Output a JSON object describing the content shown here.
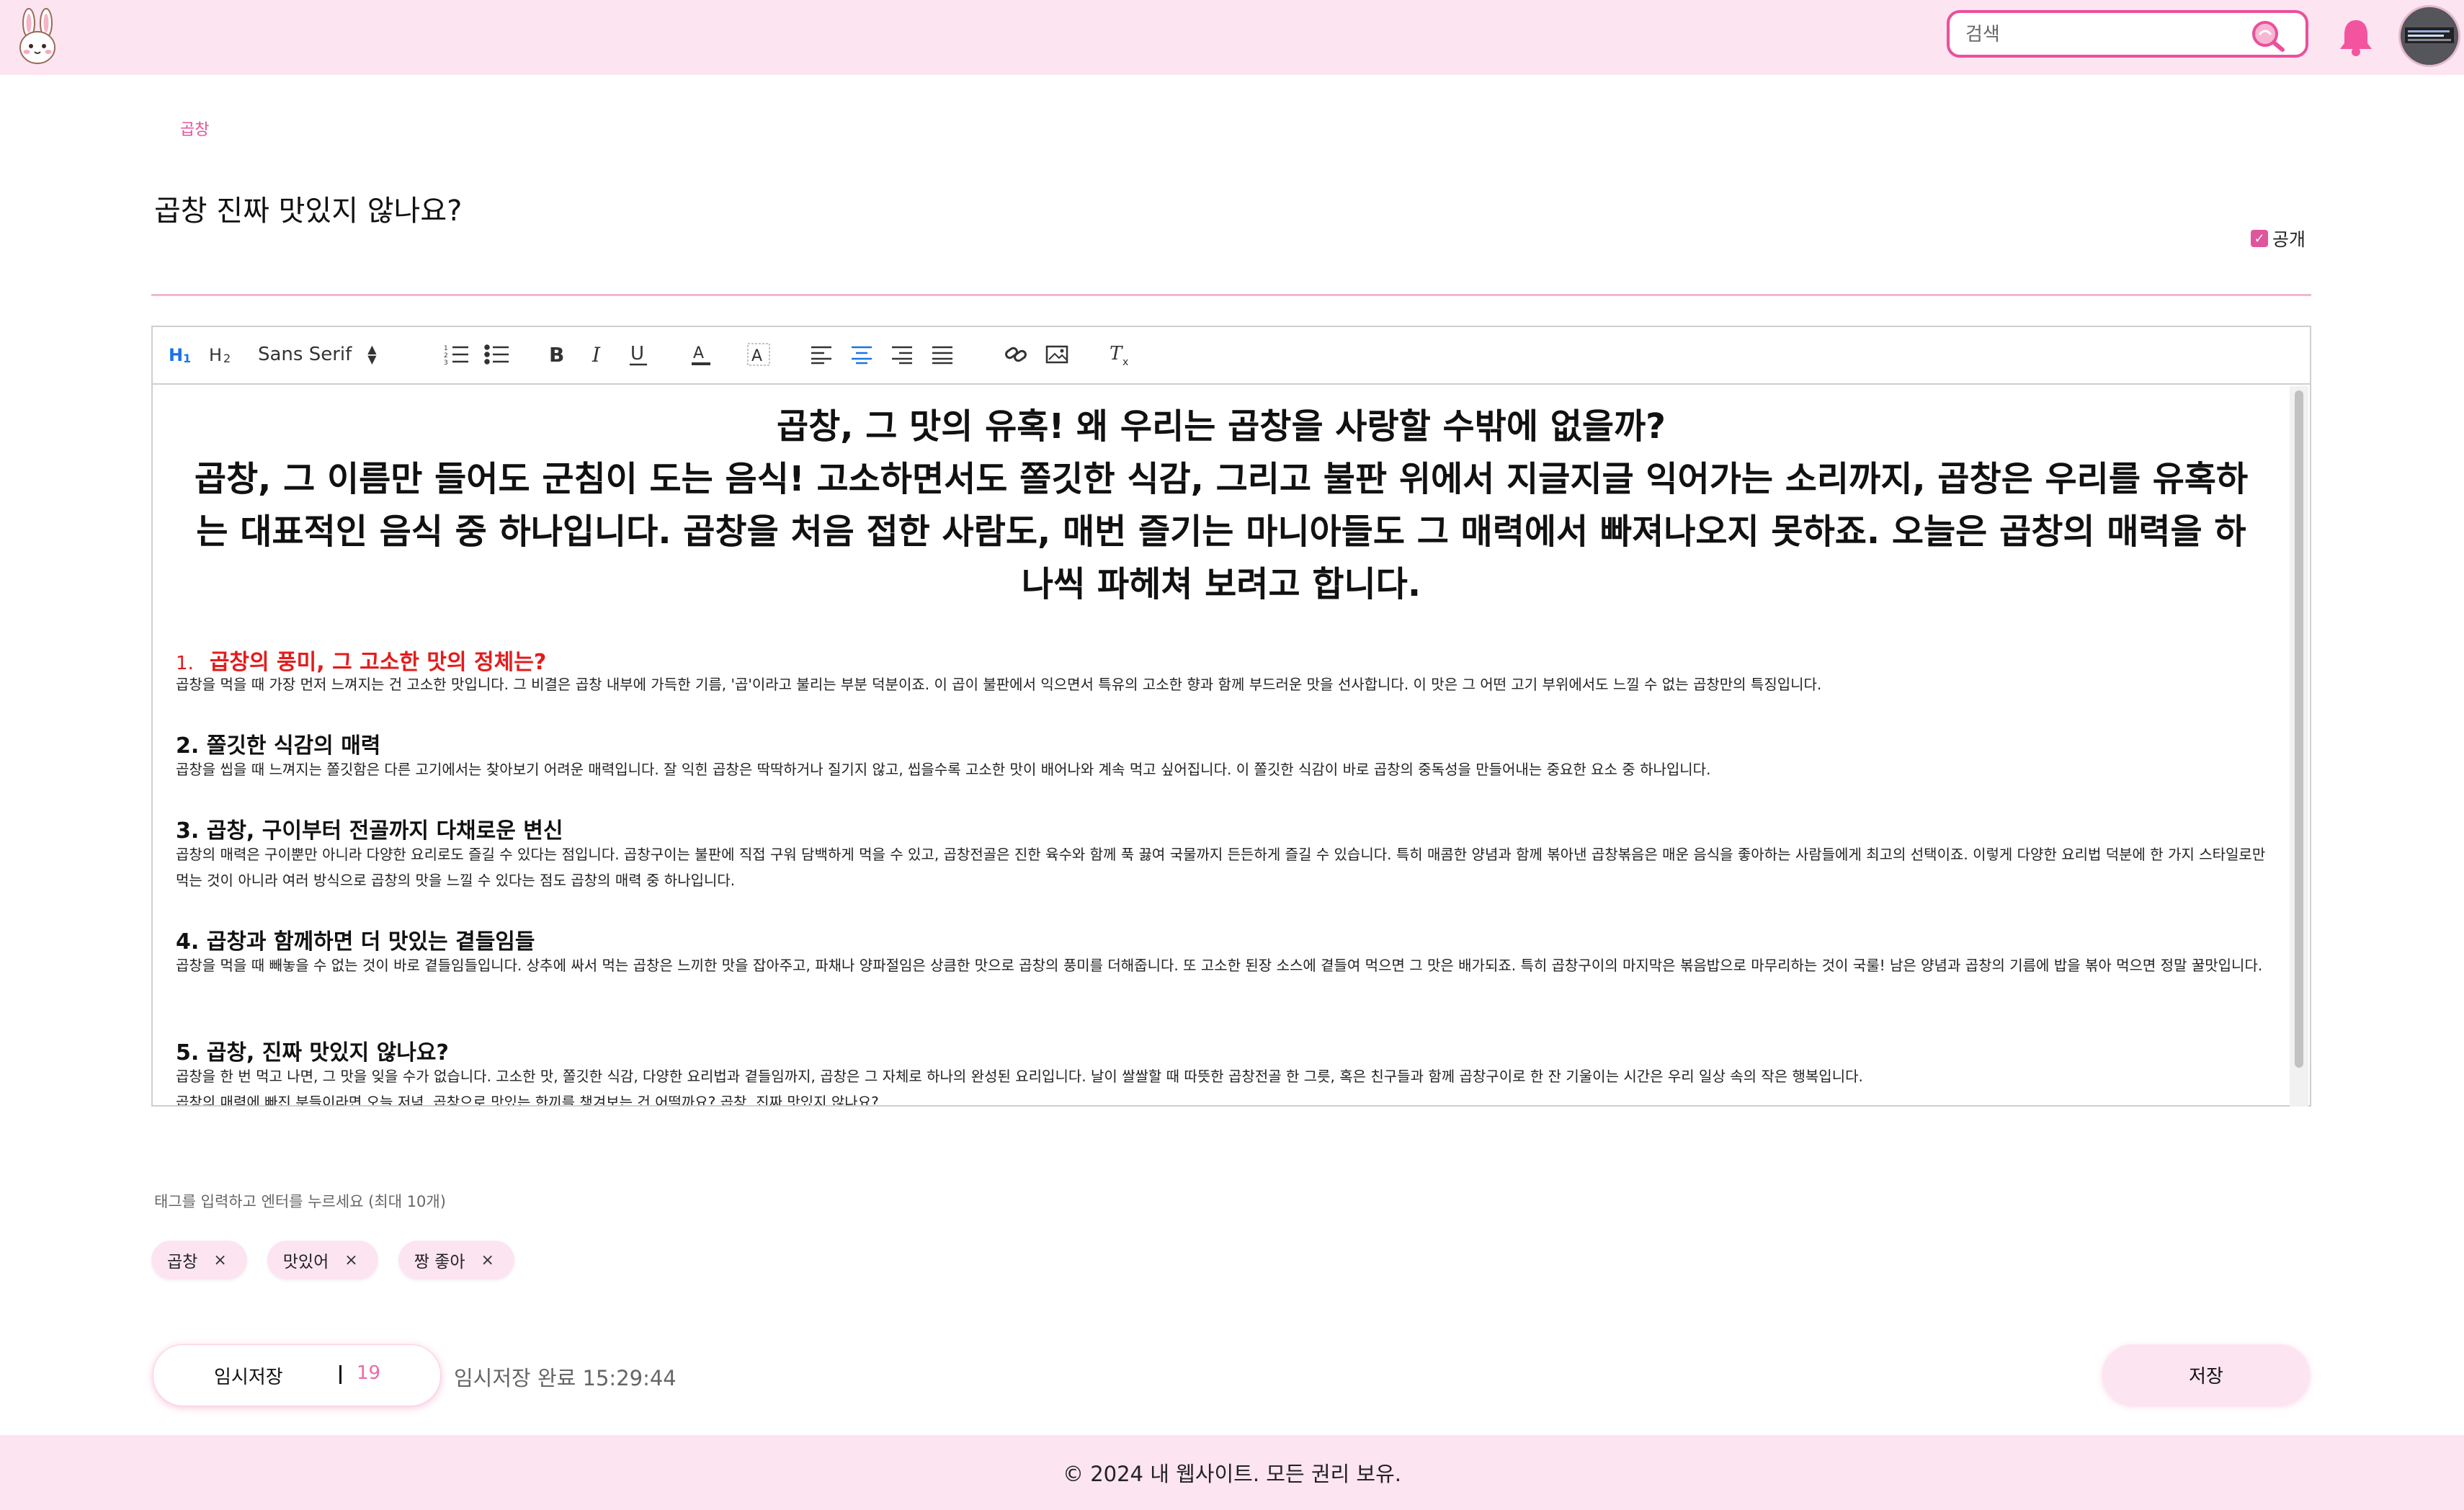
{
  "header": {
    "search_placeholder": "검색"
  },
  "post": {
    "category": "곱창",
    "title": "곱창 진짜 맛있지 않나요?",
    "public_label": "공개",
    "public_checked": true
  },
  "toolbar": {
    "font": "Sans Serif"
  },
  "content": {
    "heading_line1": "곱창, 그 맛의 유혹! 왜 우리는 곱창을 사랑할 수밖에 없을까?",
    "heading_line2": "곱창, 그 이름만 들어도 군침이 도는 음식! 고소하면서도 쫄깃한 식감, 그리고 불판 위에서 지글지글 익어가는 소리까지, 곱창은 우리를 유혹하는 대표적인 음식 중 하나입니다. 곱창을 처음 접한 사람도, 매번 즐기는 마니아들도 그 매력에서 빠져나오지 못하죠. 오늘은 곱창의 매력을 하나씩 파헤쳐 보려고 합니다.",
    "sections": [
      {
        "number": "1.",
        "title": "곱창의 풍미, 그 고소한 맛의 정체는?",
        "body": "곱창을 먹을 때 가장 먼저 느껴지는 건 고소한 맛입니다. 그 비결은 곱창 내부에 가득한 기름, '곱'이라고 불리는 부분 덕분이죠. 이 곱이 불판에서 익으면서 특유의 고소한 향과 함께 부드러운 맛을 선사합니다. 이 맛은 그 어떤 고기 부위에서도 느낄 수 없는 곱창만의 특징입니다."
      },
      {
        "title": "2. 쫄깃한 식감의 매력",
        "body": "곱창을 씹을 때 느껴지는 쫄깃함은 다른 고기에서는 찾아보기 어려운 매력입니다. 잘 익힌 곱창은 딱딱하거나 질기지 않고, 씹을수록 고소한 맛이 배어나와 계속 먹고 싶어집니다. 이 쫄깃한 식감이 바로 곱창의 중독성을 만들어내는 중요한 요소 중 하나입니다."
      },
      {
        "title": "3. 곱창, 구이부터 전골까지 다채로운 변신",
        "body": "곱창의 매력은 구이뿐만 아니라 다양한 요리로도 즐길 수 있다는 점입니다. 곱창구이는 불판에 직접 구워 담백하게 먹을 수 있고, 곱창전골은 진한 육수와 함께 푹 끓여 국물까지 든든하게 즐길 수 있습니다. 특히 매콤한 양념과 함께 볶아낸 곱창볶음은 매운 음식을 좋아하는 사람들에게 최고의 선택이죠. 이렇게 다양한 요리법 덕분에 한 가지 스타일로만 먹는 것이 아니라 여러 방식으로 곱창의 맛을 느낄 수 있다는 점도 곱창의 매력 중 하나입니다."
      },
      {
        "title": "4. 곱창과 함께하면 더 맛있는 곁들임들",
        "body": "곱창을 먹을 때 빼놓을 수 없는 것이 바로 곁들임들입니다. 상추에 싸서 먹는 곱창은 느끼한 맛을 잡아주고, 파채나 양파절임은 상큼한 맛으로 곱창의 풍미를 더해줍니다. 또 고소한 된장 소스에 곁들여 먹으면 그 맛은 배가되죠. 특히 곱창구이의 마지막은 볶음밥으로 마무리하는 것이 국룰! 남은 양념과 곱창의 기름에 밥을 볶아 먹으면 정말 꿀맛입니다."
      },
      {
        "title": "5. 곱창, 진짜 맛있지 않나요?",
        "body": "곱창을 한 번 먹고 나면, 그 맛을 잊을 수가 없습니다. 고소한 맛, 쫄깃한 식감, 다양한 요리법과 곁들임까지, 곱창은 그 자체로 하나의 완성된 요리입니다. 날이 쌀쌀할 때 따뜻한 곱창전골 한 그릇, 혹은 친구들과 함께 곱창구이로 한 잔 기울이는 시간은 우리 일상 속의 작은 행복입니다.",
        "body2": "곱창의 매력에 빠진 분들이라면 오늘 저녁, 곱창으로 맛있는 한끼를 챙겨보는 건 어떨까요? 곱창, 진짜 맛있지 않나요?"
      }
    ]
  },
  "tags": {
    "hint": "태그를 입력하고 엔터를 누르세요 (최대 10개)",
    "items": [
      "곱창",
      "맛있어",
      "짱 좋아"
    ],
    "remove_symbol": "×"
  },
  "actions": {
    "temp_save_label": "임시저장",
    "temp_save_count": "19",
    "temp_save_status": "임시저장 완료 15:29:44",
    "save_label": "저장"
  },
  "footer": {
    "text": "© 2024 내 웹사이트. 모든 권리 보유."
  },
  "colors": {
    "brand_pink": "#ec4f9c",
    "header_bg": "#fde4f1",
    "accent_red": "#e41b1b"
  }
}
